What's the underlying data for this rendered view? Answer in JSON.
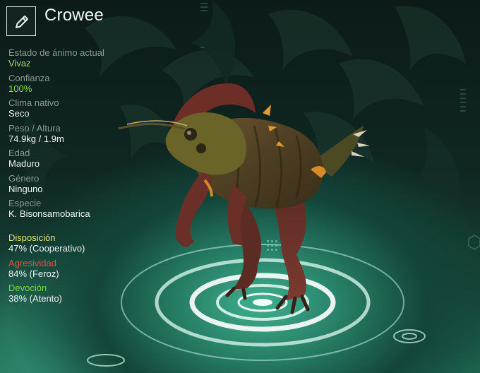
{
  "creature": {
    "name": "Crowee",
    "edit_icon": "pencil-icon"
  },
  "stats": [
    {
      "label": "Estado de ánimo actual",
      "value": "Vivaz"
    },
    {
      "label": "Confianza",
      "value": "100%"
    },
    {
      "label": "Clima nativo",
      "value": "Seco"
    },
    {
      "label": "Peso / Altura",
      "value": "74.9kg / 1.9m"
    },
    {
      "label": "Edad",
      "value": "Maduro"
    },
    {
      "label": "Género",
      "value": "Ninguno"
    },
    {
      "label": "Especie",
      "value": "K. Bisonsamobarica"
    }
  ],
  "behaviour": [
    {
      "label": "Disposición",
      "value": "47% (Cooperativo)"
    },
    {
      "label": "Agresividad",
      "value": "84% (Feroz)"
    },
    {
      "label": "Devoción",
      "value": "38% (Atento)"
    }
  ],
  "colors": {
    "mood_value": "#9ee05a",
    "trust_value": "#7ee84a",
    "disposition_label": "#e8e07a",
    "aggression_label": "#e0533e",
    "devotion_label": "#7ed64a",
    "pad_glow": "#dffaf0"
  }
}
